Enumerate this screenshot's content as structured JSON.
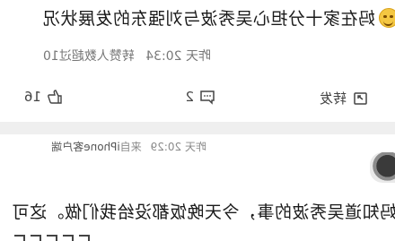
{
  "post1": {
    "text": "妈在家十分担心吴秀波与刘强东的发展状况",
    "time": "昨天 20:34",
    "views": "转赞人数超过10",
    "actions": {
      "forward": "转发",
      "comment": "2",
      "like": "16"
    }
  },
  "post2": {
    "time": "昨天 20:29",
    "source_prefix": "来自",
    "source": "iPhone客户端",
    "text": "妈知道吴秀波的事，今天晚饭都没给我们做。这可"
  },
  "colors": {
    "text": "#1a1a1a",
    "meta": "#777777",
    "separator": "#efefef",
    "emoji": "#f4c742"
  }
}
